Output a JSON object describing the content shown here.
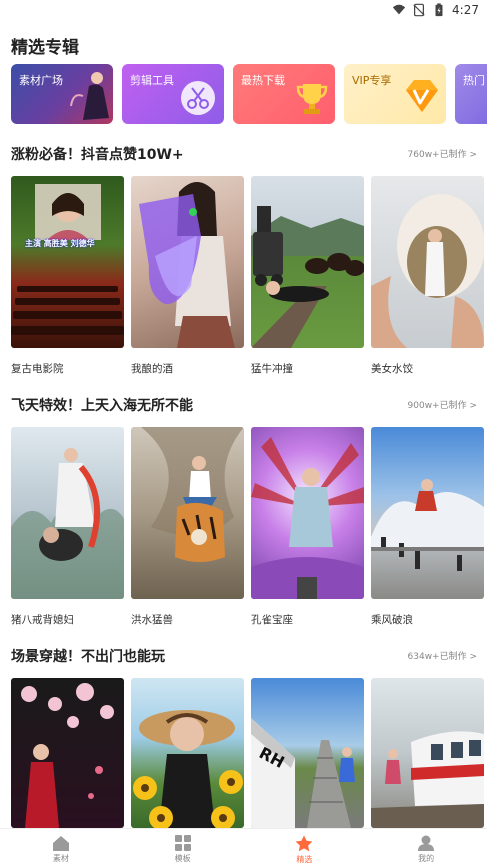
{
  "status_bar": {
    "time": "4:27"
  },
  "page_title": "精选专辑",
  "categories": [
    {
      "label": "素材广场"
    },
    {
      "label": "剪辑工具"
    },
    {
      "label": "最热下载"
    },
    {
      "label": "VIP专享"
    },
    {
      "label": "热门"
    }
  ],
  "sections": [
    {
      "title": "涨粉必备！抖音点赞10W+",
      "meta": "760w+已制作 >",
      "cards": [
        {
          "label": "复古电影院",
          "thumb_text": "主演 高胜美 刘德华"
        },
        {
          "label": "我酿的酒"
        },
        {
          "label": "猛牛冲撞"
        },
        {
          "label": "美女水饺"
        }
      ]
    },
    {
      "title": "飞天特效！上天入海无所不能",
      "meta": "900w+已制作 >",
      "cards": [
        {
          "label": "猪八戒背媳妇"
        },
        {
          "label": "洪水猛兽"
        },
        {
          "label": "孔雀宝座"
        },
        {
          "label": "乘风破浪"
        }
      ]
    },
    {
      "title": "场景穿越！不出门也能玩",
      "meta": "634w+已制作 >",
      "cards": [
        {
          "label": ""
        },
        {
          "label": ""
        },
        {
          "label": "",
          "thumb_text": "RH"
        },
        {
          "label": ""
        }
      ]
    }
  ],
  "tabs": [
    {
      "label": "素材",
      "icon": "home-icon"
    },
    {
      "label": "模板",
      "icon": "grid-icon"
    },
    {
      "label": "精选",
      "icon": "star-icon"
    },
    {
      "label": "我的",
      "icon": "user-icon"
    }
  ],
  "colors": {
    "accent": "#ff6a3d"
  }
}
